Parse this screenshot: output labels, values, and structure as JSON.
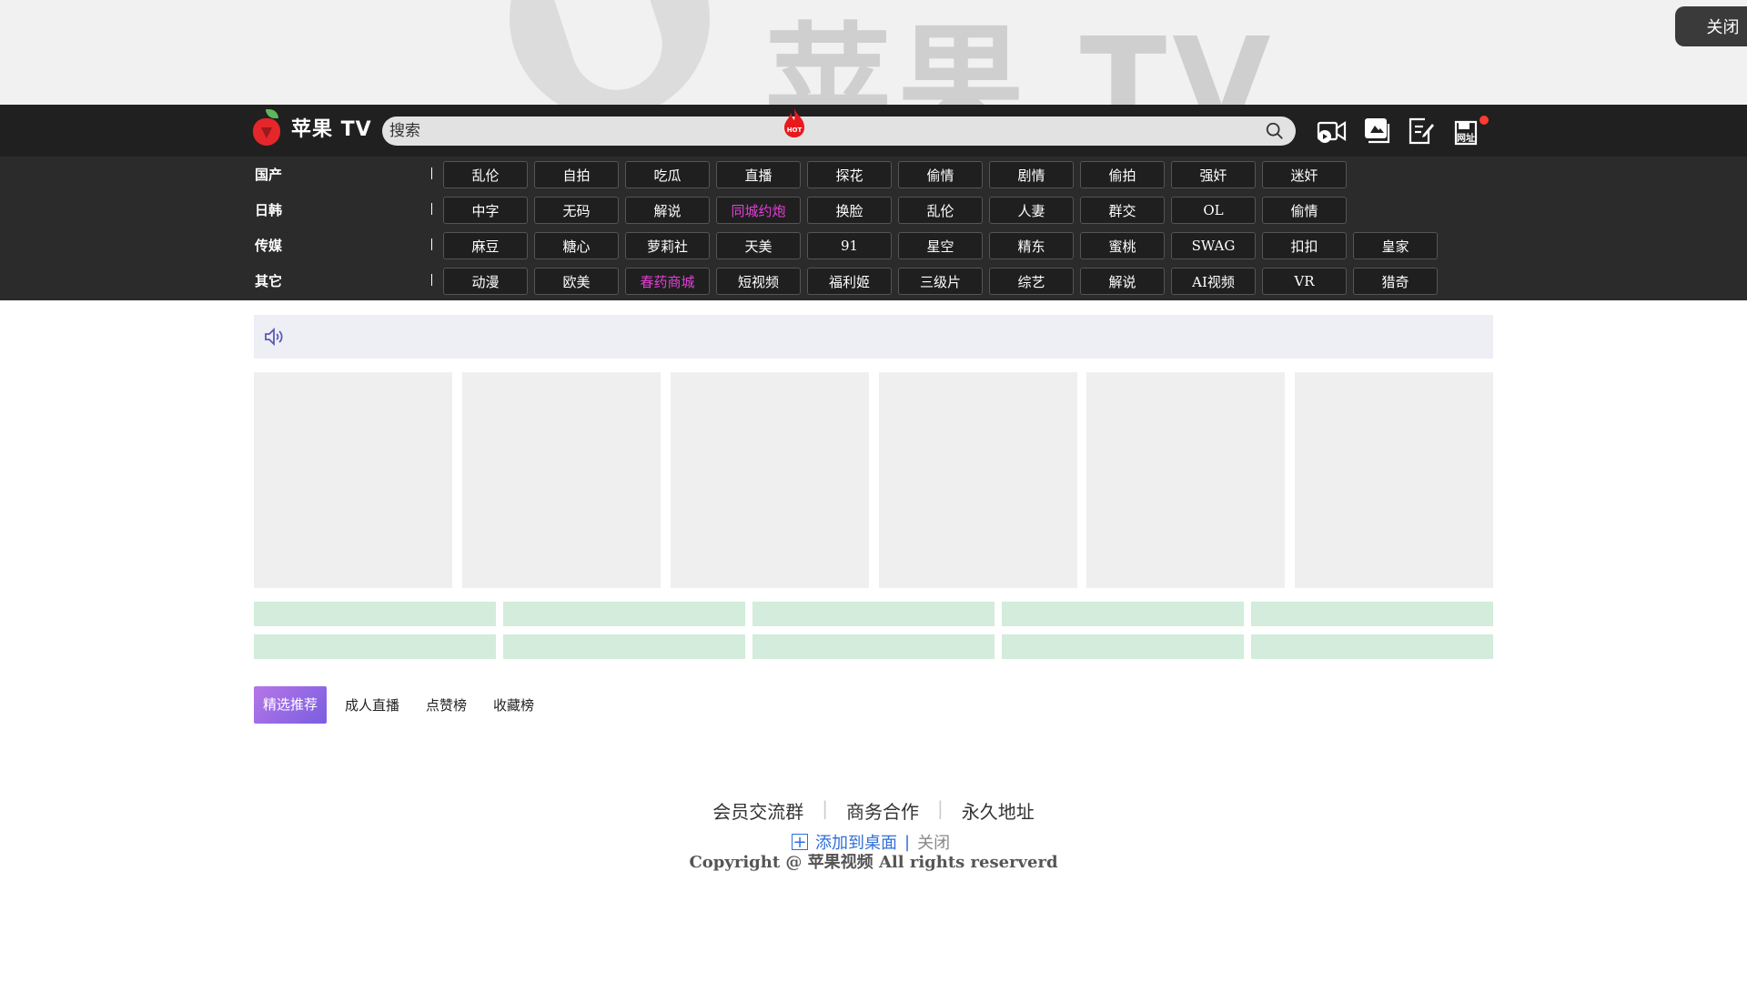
{
  "top_banner": {
    "watermark_text": "苹果 TV",
    "close_label": "关闭"
  },
  "header": {
    "logo_text": "苹果 TV",
    "search_placeholder": "搜索",
    "icons": [
      "video-upload-icon",
      "gallery-icon",
      "notes-icon",
      "website-icon"
    ],
    "website_label": "网址"
  },
  "categories": [
    {
      "name": "国产",
      "tags": [
        {
          "label": "乱伦"
        },
        {
          "label": "自拍"
        },
        {
          "label": "吃瓜"
        },
        {
          "label": "直播"
        },
        {
          "label": "探花"
        },
        {
          "label": "偷情"
        },
        {
          "label": "剧情"
        },
        {
          "label": "偷拍"
        },
        {
          "label": "强奸"
        },
        {
          "label": "迷奸"
        }
      ]
    },
    {
      "name": "日韩",
      "tags": [
        {
          "label": "中字"
        },
        {
          "label": "无码"
        },
        {
          "label": "解说"
        },
        {
          "label": "同城约炮",
          "highlight": true
        },
        {
          "label": "换脸"
        },
        {
          "label": "乱伦"
        },
        {
          "label": "人妻"
        },
        {
          "label": "群交"
        },
        {
          "label": "OL"
        },
        {
          "label": "偷情"
        }
      ]
    },
    {
      "name": "传媒",
      "tags": [
        {
          "label": "麻豆"
        },
        {
          "label": "糖心"
        },
        {
          "label": "萝莉社"
        },
        {
          "label": "天美"
        },
        {
          "label": "91"
        },
        {
          "label": "星空"
        },
        {
          "label": "精东"
        },
        {
          "label": "蜜桃"
        },
        {
          "label": "SWAG"
        },
        {
          "label": "扣扣"
        },
        {
          "label": "皇家"
        }
      ]
    },
    {
      "name": "其它",
      "tags": [
        {
          "label": "动漫"
        },
        {
          "label": "欧美"
        },
        {
          "label": "春药商城",
          "highlight": true
        },
        {
          "label": "短视频",
          "hot": true
        },
        {
          "label": "福利姬"
        },
        {
          "label": "三级片"
        },
        {
          "label": "综艺"
        },
        {
          "label": "解说"
        },
        {
          "label": "AI视频"
        },
        {
          "label": "VR"
        },
        {
          "label": "猎奇"
        }
      ]
    }
  ],
  "hot_badge": "HOT",
  "tabs": [
    {
      "label": "精选推荐",
      "active": true
    },
    {
      "label": "成人直播"
    },
    {
      "label": "点赞榜"
    },
    {
      "label": "收藏榜"
    }
  ],
  "footer": {
    "links": [
      "会员交流群",
      "商务合作",
      "永久地址"
    ],
    "copyright": "Copyright @ 苹果视频 All rights reserverd",
    "add_to_desktop": "添加到桌面",
    "close": "关闭"
  },
  "colors": {
    "accent_pink": "#e23fd6",
    "header_bg": "#202020",
    "tab_gradient_start": "#b676e8",
    "tab_gradient_end": "#7a5ee0",
    "link_blue": "#2f6fd9"
  }
}
